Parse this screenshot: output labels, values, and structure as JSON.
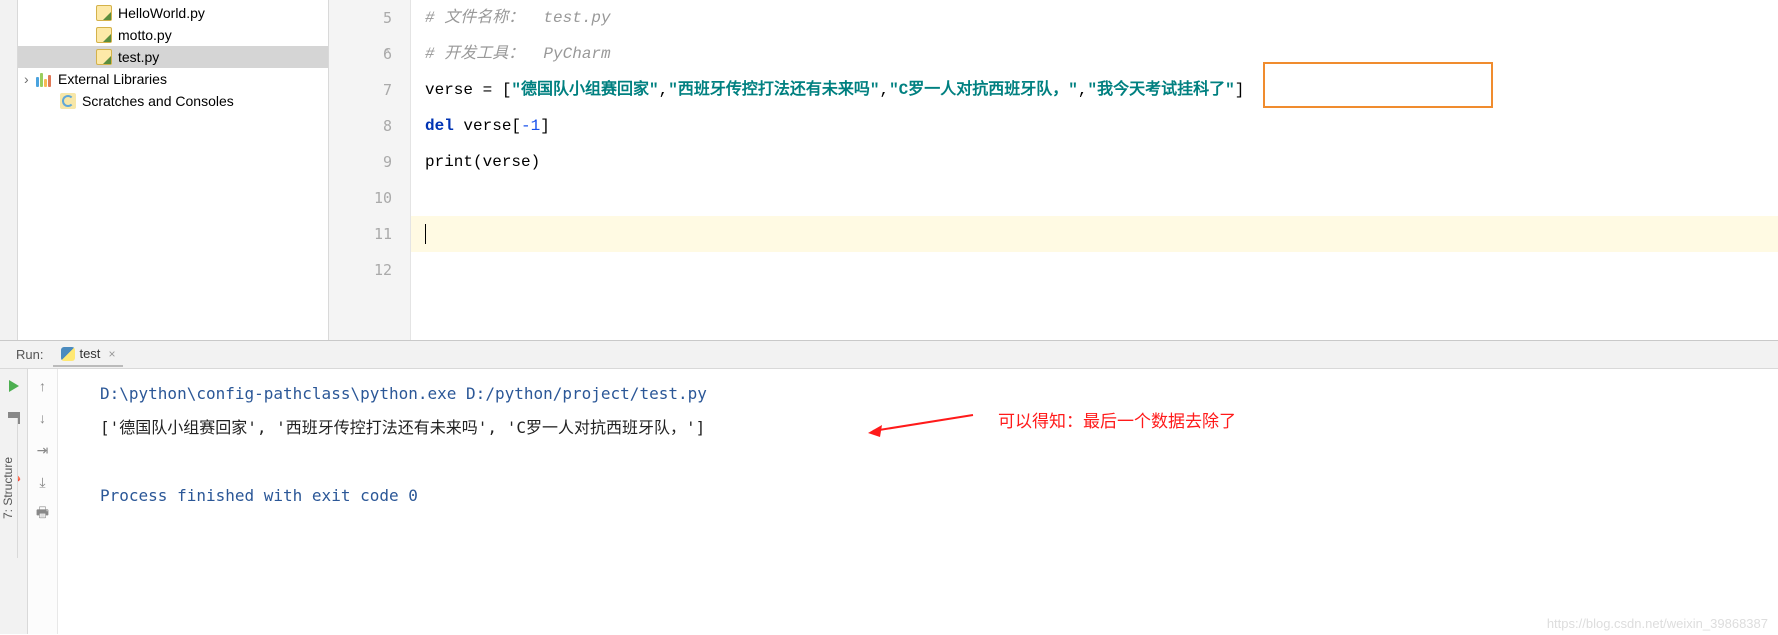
{
  "project_tree": {
    "files": [
      {
        "name": "HelloWorld.py"
      },
      {
        "name": "motto.py"
      },
      {
        "name": "test.py"
      }
    ],
    "external_libraries": "External Libraries",
    "scratches": "Scratches and Consoles"
  },
  "editor": {
    "lines": {
      "5": {
        "comment": "# 文件名称：  test.py"
      },
      "6": {
        "comment": "# 开发工具：  PyCharm"
      },
      "7": {
        "var": "verse",
        "s1": "\"德国队小组赛回家\"",
        "s2": "\"西班牙传控打法还有未来吗\"",
        "s3": "\"C罗一人对抗西班牙队，\"",
        "s4": "\"我今天考试挂科了\""
      },
      "8": {
        "kw": "del",
        "expr": " verse[",
        "idx": "-1",
        "close": "]"
      },
      "9": {
        "fn": "print",
        "arg": "(verse)"
      }
    },
    "line_numbers": [
      "5",
      "6",
      "7",
      "8",
      "9",
      "10",
      "11",
      "12"
    ]
  },
  "run": {
    "label": "Run:",
    "tab_name": "test",
    "command": "D:\\python\\config-pathclass\\python.exe D:/python/project/test.py",
    "output": "['德国队小组赛回家', '西班牙传控打法还有未来吗', 'C罗一人对抗西班牙队，']",
    "exit": "Process finished with exit code 0"
  },
  "annotation": "可以得知：最后一个数据去除了",
  "structure_tab": "7: Structure",
  "watermark": "https://blog.csdn.net/weixin_39868387"
}
